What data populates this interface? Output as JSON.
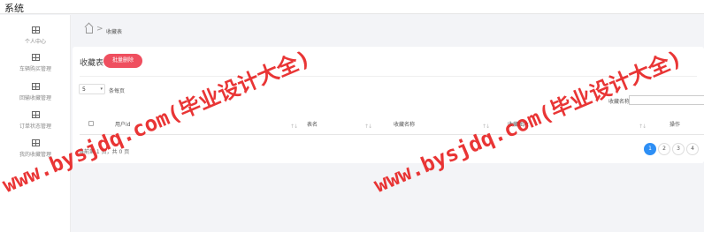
{
  "app": {
    "title": "系统"
  },
  "sidebar": {
    "items": [
      {
        "label": "个人中心"
      },
      {
        "label": "车辆购买管理"
      },
      {
        "label": "回输收藏管理"
      },
      {
        "label": "订单状态管理"
      },
      {
        "label": "我的收藏管理"
      }
    ]
  },
  "breadcrumb": {
    "separator": ">",
    "current": "收藏表"
  },
  "panel": {
    "title": "收藏表",
    "delete_button": "批量删除",
    "page_size": "5",
    "per_page_label": "条每页",
    "search_label": "收藏名称",
    "search_value": ""
  },
  "table": {
    "columns": [
      {
        "label": "用户id",
        "sortable": true
      },
      {
        "label": "表名",
        "sortable": true
      },
      {
        "label": "收藏名称",
        "sortable": true
      },
      {
        "label": "收藏图片",
        "sortable": true
      },
      {
        "label": "操作",
        "sortable": false
      }
    ],
    "sort_icon": "↑↓",
    "rows": []
  },
  "footer": {
    "summary": "当前第 1 页，共 0 页",
    "pages": [
      "1",
      "2",
      "3",
      "4"
    ],
    "active_page": "1"
  },
  "watermark": {
    "text1": "www.bysjdq.com(毕业设计大全)",
    "text2": "www.bysjdq.com(毕业设计大全)"
  }
}
